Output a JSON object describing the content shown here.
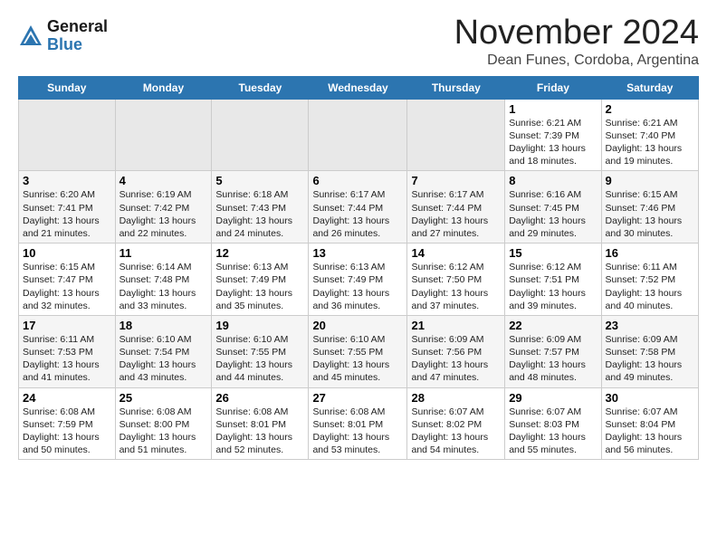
{
  "logo": {
    "general": "General",
    "blue": "Blue"
  },
  "header": {
    "month": "November 2024",
    "location": "Dean Funes, Cordoba, Argentina"
  },
  "weekdays": [
    "Sunday",
    "Monday",
    "Tuesday",
    "Wednesday",
    "Thursday",
    "Friday",
    "Saturday"
  ],
  "weeks": [
    [
      {
        "day": "",
        "info": ""
      },
      {
        "day": "",
        "info": ""
      },
      {
        "day": "",
        "info": ""
      },
      {
        "day": "",
        "info": ""
      },
      {
        "day": "",
        "info": ""
      },
      {
        "day": "1",
        "info": "Sunrise: 6:21 AM\nSunset: 7:39 PM\nDaylight: 13 hours\nand 18 minutes."
      },
      {
        "day": "2",
        "info": "Sunrise: 6:21 AM\nSunset: 7:40 PM\nDaylight: 13 hours\nand 19 minutes."
      }
    ],
    [
      {
        "day": "3",
        "info": "Sunrise: 6:20 AM\nSunset: 7:41 PM\nDaylight: 13 hours\nand 21 minutes."
      },
      {
        "day": "4",
        "info": "Sunrise: 6:19 AM\nSunset: 7:42 PM\nDaylight: 13 hours\nand 22 minutes."
      },
      {
        "day": "5",
        "info": "Sunrise: 6:18 AM\nSunset: 7:43 PM\nDaylight: 13 hours\nand 24 minutes."
      },
      {
        "day": "6",
        "info": "Sunrise: 6:17 AM\nSunset: 7:44 PM\nDaylight: 13 hours\nand 26 minutes."
      },
      {
        "day": "7",
        "info": "Sunrise: 6:17 AM\nSunset: 7:44 PM\nDaylight: 13 hours\nand 27 minutes."
      },
      {
        "day": "8",
        "info": "Sunrise: 6:16 AM\nSunset: 7:45 PM\nDaylight: 13 hours\nand 29 minutes."
      },
      {
        "day": "9",
        "info": "Sunrise: 6:15 AM\nSunset: 7:46 PM\nDaylight: 13 hours\nand 30 minutes."
      }
    ],
    [
      {
        "day": "10",
        "info": "Sunrise: 6:15 AM\nSunset: 7:47 PM\nDaylight: 13 hours\nand 32 minutes."
      },
      {
        "day": "11",
        "info": "Sunrise: 6:14 AM\nSunset: 7:48 PM\nDaylight: 13 hours\nand 33 minutes."
      },
      {
        "day": "12",
        "info": "Sunrise: 6:13 AM\nSunset: 7:49 PM\nDaylight: 13 hours\nand 35 minutes."
      },
      {
        "day": "13",
        "info": "Sunrise: 6:13 AM\nSunset: 7:49 PM\nDaylight: 13 hours\nand 36 minutes."
      },
      {
        "day": "14",
        "info": "Sunrise: 6:12 AM\nSunset: 7:50 PM\nDaylight: 13 hours\nand 37 minutes."
      },
      {
        "day": "15",
        "info": "Sunrise: 6:12 AM\nSunset: 7:51 PM\nDaylight: 13 hours\nand 39 minutes."
      },
      {
        "day": "16",
        "info": "Sunrise: 6:11 AM\nSunset: 7:52 PM\nDaylight: 13 hours\nand 40 minutes."
      }
    ],
    [
      {
        "day": "17",
        "info": "Sunrise: 6:11 AM\nSunset: 7:53 PM\nDaylight: 13 hours\nand 41 minutes."
      },
      {
        "day": "18",
        "info": "Sunrise: 6:10 AM\nSunset: 7:54 PM\nDaylight: 13 hours\nand 43 minutes."
      },
      {
        "day": "19",
        "info": "Sunrise: 6:10 AM\nSunset: 7:55 PM\nDaylight: 13 hours\nand 44 minutes."
      },
      {
        "day": "20",
        "info": "Sunrise: 6:10 AM\nSunset: 7:55 PM\nDaylight: 13 hours\nand 45 minutes."
      },
      {
        "day": "21",
        "info": "Sunrise: 6:09 AM\nSunset: 7:56 PM\nDaylight: 13 hours\nand 47 minutes."
      },
      {
        "day": "22",
        "info": "Sunrise: 6:09 AM\nSunset: 7:57 PM\nDaylight: 13 hours\nand 48 minutes."
      },
      {
        "day": "23",
        "info": "Sunrise: 6:09 AM\nSunset: 7:58 PM\nDaylight: 13 hours\nand 49 minutes."
      }
    ],
    [
      {
        "day": "24",
        "info": "Sunrise: 6:08 AM\nSunset: 7:59 PM\nDaylight: 13 hours\nand 50 minutes."
      },
      {
        "day": "25",
        "info": "Sunrise: 6:08 AM\nSunset: 8:00 PM\nDaylight: 13 hours\nand 51 minutes."
      },
      {
        "day": "26",
        "info": "Sunrise: 6:08 AM\nSunset: 8:01 PM\nDaylight: 13 hours\nand 52 minutes."
      },
      {
        "day": "27",
        "info": "Sunrise: 6:08 AM\nSunset: 8:01 PM\nDaylight: 13 hours\nand 53 minutes."
      },
      {
        "day": "28",
        "info": "Sunrise: 6:07 AM\nSunset: 8:02 PM\nDaylight: 13 hours\nand 54 minutes."
      },
      {
        "day": "29",
        "info": "Sunrise: 6:07 AM\nSunset: 8:03 PM\nDaylight: 13 hours\nand 55 minutes."
      },
      {
        "day": "30",
        "info": "Sunrise: 6:07 AM\nSunset: 8:04 PM\nDaylight: 13 hours\nand 56 minutes."
      }
    ]
  ]
}
